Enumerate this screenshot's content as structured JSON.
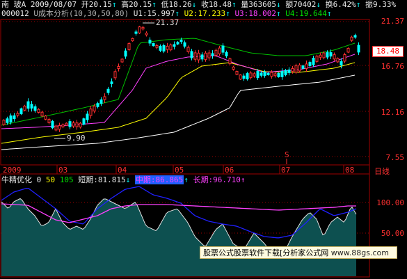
{
  "header": {
    "row1": {
      "stock_name": "南  玻A",
      "date": "2009/08/07",
      "open": "开20.15",
      "high": "高20.15",
      "low": "低18.26",
      "close": "收18.48",
      "volume": "量363605",
      "amount": "额70402",
      "turnover": "换6.42%",
      "amplitude": "振9.33%"
    },
    "row2": {
      "code": "000012",
      "indicator": "U成本分析(10,30,50,80)",
      "u1": "U1:15.997",
      "u2": "U2:17.233",
      "u3": "U3:18.002",
      "u4": "U4:19.644"
    }
  },
  "price_axis": {
    "labels": [
      "21.37",
      "18.48",
      "16.76",
      "12.16",
      "7.55"
    ]
  },
  "annotations": {
    "high_mark": "21.37",
    "low_mark": "9.90",
    "s_marker": "S"
  },
  "time_axis": {
    "labels": [
      "2009",
      "03",
      "04",
      "05",
      "06",
      "07",
      "08"
    ],
    "period_button": "日线"
  },
  "indicator": {
    "name": "牛精优化",
    "level0": "0",
    "level50": "50",
    "level105": "105",
    "short": "短期:81.815",
    "mid": "中期:86.865",
    "long": "长期:96.710",
    "axis_labels": [
      "100.00",
      "50.00"
    ]
  },
  "banner": {
    "text": "股票公式股票软件下载[分析家公式网",
    "url": "www.88gs.com"
  },
  "colors": {
    "up": "#ff3030",
    "down": "#00ffff",
    "ma_white": "#ffffff",
    "ma_yellow": "#ffff00",
    "ma_magenta": "#ff40ff",
    "ma_green": "#00c000",
    "grid": "#a00000"
  }
}
